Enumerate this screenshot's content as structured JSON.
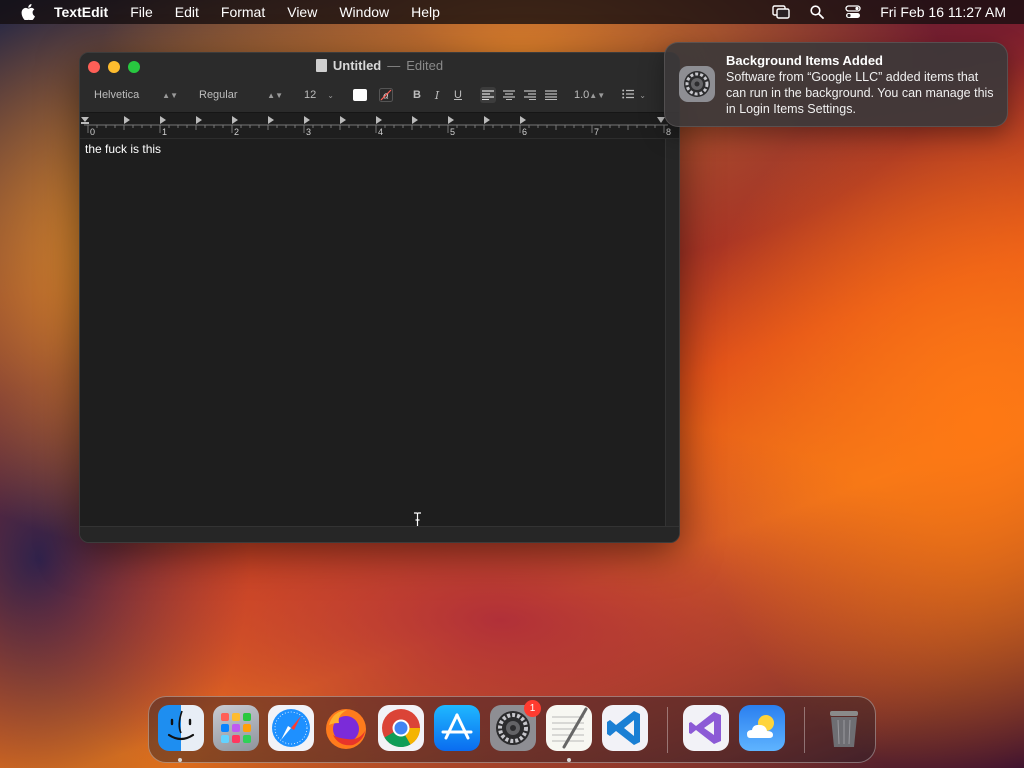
{
  "menubar": {
    "app_name": "TextEdit",
    "items": [
      "File",
      "Edit",
      "Format",
      "View",
      "Window",
      "Help"
    ],
    "clock": "Fri Feb 16  11:27 AM"
  },
  "window": {
    "title": "Untitled",
    "title_separator": "—",
    "title_status": "Edited",
    "toolbar": {
      "font_family": "Helvetica",
      "font_style": "Regular",
      "font_size": "12",
      "bold": "B",
      "italic": "I",
      "underline": "U",
      "line_spacing": "1.0"
    },
    "ruler_labels": [
      "0",
      "1",
      "2",
      "3",
      "4",
      "5",
      "6",
      "7",
      "8"
    ],
    "document_text": "the fuck is this"
  },
  "notification": {
    "title": "Background Items Added",
    "body": "Software from “Google LLC” added items that can run in the background. You can manage this in Login Items Settings."
  },
  "dock": {
    "items": [
      "Finder",
      "Launchpad",
      "Safari",
      "Firefox",
      "Google Chrome",
      "App Store",
      "System Settings",
      "TextEdit",
      "Visual Studio Code",
      "Visual Studio",
      "Weather",
      "Trash"
    ],
    "system_settings_badge": "1"
  },
  "colors": {
    "close": "#ff5f57",
    "minimize": "#febc2e",
    "maximize": "#28c840",
    "badge": "#ff3b30"
  }
}
